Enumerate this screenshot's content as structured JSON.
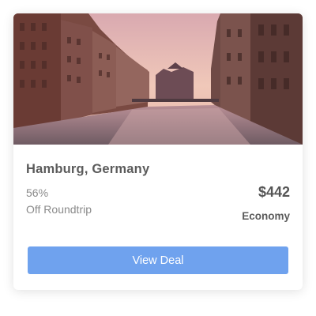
{
  "deal": {
    "title": "Hamburg, Germany",
    "discount": "56%",
    "discount_note": "Off Roundtrip",
    "price": "$442",
    "fare_class": "Economy",
    "button_label": "View Deal"
  },
  "colors": {
    "button": "#6fa2ee",
    "title_text": "#5b5b5b",
    "muted_text": "#8a8a8a"
  }
}
